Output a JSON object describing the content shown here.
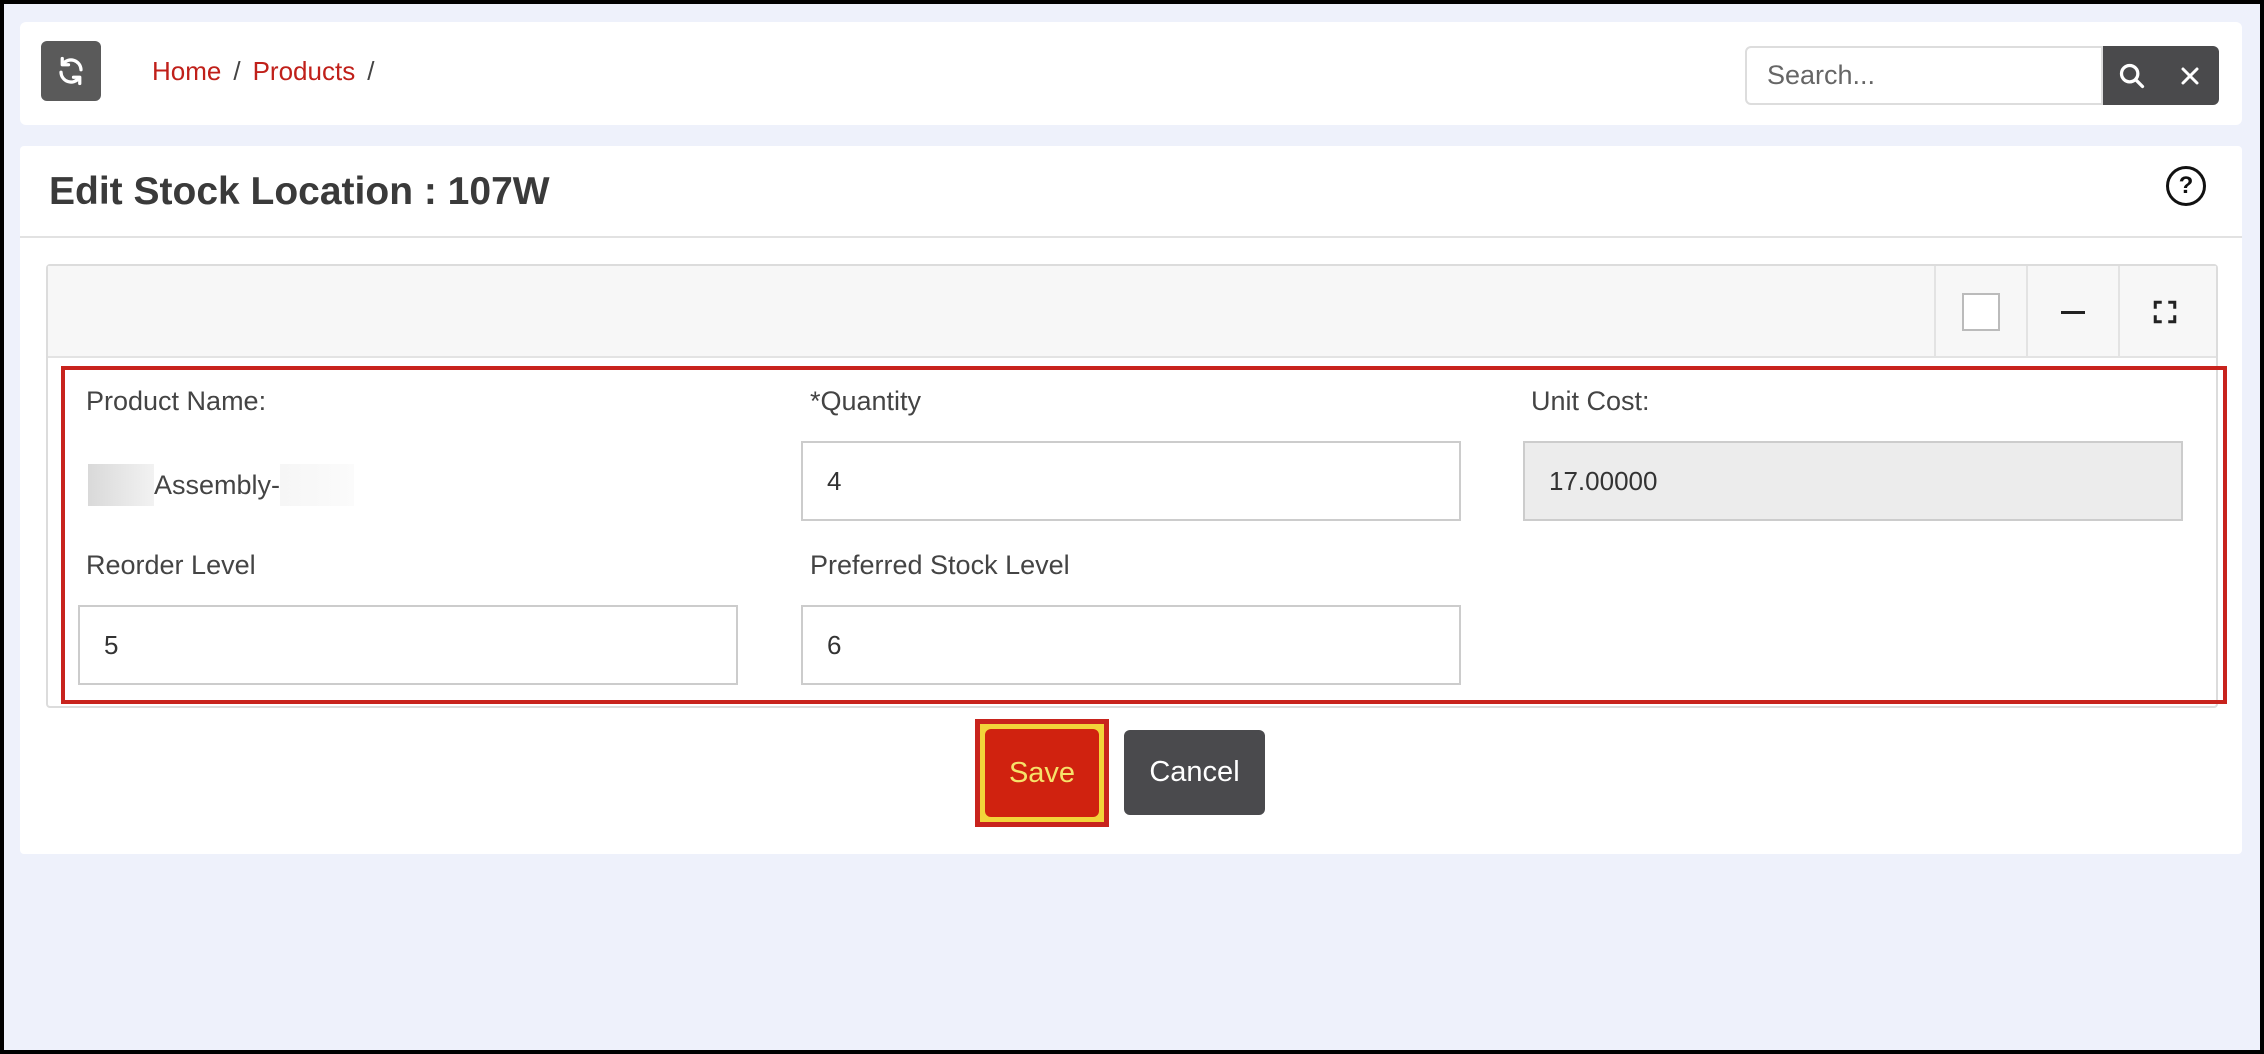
{
  "breadcrumb": {
    "home": "Home",
    "products": "Products",
    "separator": "/"
  },
  "search": {
    "placeholder": "Search...",
    "value": ""
  },
  "page": {
    "title": "Edit Stock Location : 107W"
  },
  "form": {
    "product_name_label": "Product Name:",
    "product_name_value": "Assembly-",
    "quantity_label": "*Quantity",
    "quantity_value": "4",
    "unit_cost_label": "Unit Cost:",
    "unit_cost_value": "17.00000",
    "reorder_level_label": "Reorder Level",
    "reorder_level_value": "5",
    "preferred_stock_label": "Preferred Stock Level",
    "preferred_stock_value": "6"
  },
  "actions": {
    "save_label": "Save",
    "cancel_label": "Cancel"
  },
  "icons": {
    "refresh": "refresh-icon",
    "search": "search-icon",
    "clear": "close-icon",
    "help": "help-icon",
    "minimize": "minus-icon",
    "fullscreen": "expand-icon"
  },
  "colors": {
    "accent": "#c0201a",
    "save_button": "#d0220f",
    "dark_button": "#4a4a4d"
  }
}
